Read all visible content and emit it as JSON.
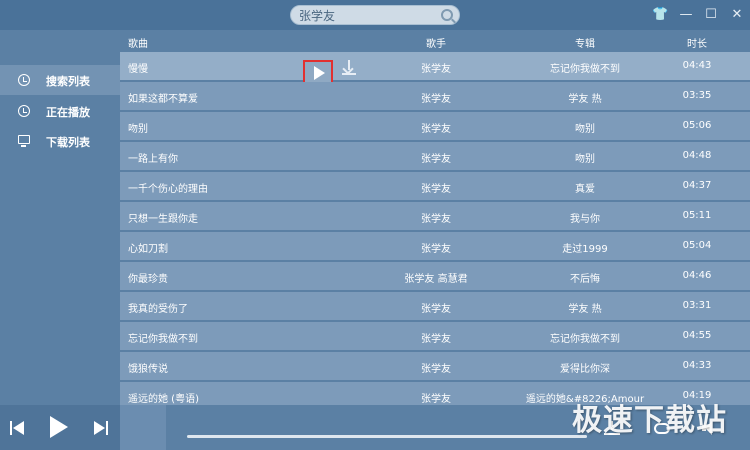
{
  "search": {
    "value": "张学友"
  },
  "sidebar": {
    "items": [
      {
        "label": "搜索列表",
        "icon": "clock-icon",
        "active": true
      },
      {
        "label": "正在播放",
        "icon": "clock-icon",
        "active": false
      },
      {
        "label": "下载列表",
        "icon": "monitor-icon",
        "active": false
      }
    ]
  },
  "table": {
    "headers": {
      "song": "歌曲",
      "artist": "歌手",
      "album": "专辑",
      "duration": "时长"
    },
    "rows": [
      {
        "song": "慢慢",
        "artist": "张学友",
        "album": "忘记你我做不到",
        "duration": "04:43"
      },
      {
        "song": "如果这都不算爱",
        "artist": "张学友",
        "album": "学友 热",
        "duration": "03:35"
      },
      {
        "song": "吻别",
        "artist": "张学友",
        "album": "吻别",
        "duration": "05:06"
      },
      {
        "song": "一路上有你",
        "artist": "张学友",
        "album": "吻别",
        "duration": "04:48"
      },
      {
        "song": "一千个伤心的理由",
        "artist": "张学友",
        "album": "真爱",
        "duration": "04:37"
      },
      {
        "song": "只想一生跟你走",
        "artist": "张学友",
        "album": "我与你",
        "duration": "05:11"
      },
      {
        "song": "心如刀割",
        "artist": "张学友",
        "album": "走过1999",
        "duration": "05:04"
      },
      {
        "song": "你最珍贵",
        "artist": "张学友 高慧君",
        "album": "不后悔",
        "duration": "04:46"
      },
      {
        "song": "我真的受伤了",
        "artist": "张学友",
        "album": "学友 热",
        "duration": "03:31"
      },
      {
        "song": "忘记你我做不到",
        "artist": "张学友",
        "album": "忘记你我做不到",
        "duration": "04:55"
      },
      {
        "song": "饿狼传说",
        "artist": "张学友",
        "album": "爱得比你深",
        "duration": "04:33"
      },
      {
        "song": "遥远的她 (粤语)",
        "artist": "张学友",
        "album": "遥远的她&#8226;Amour",
        "duration": "04:19"
      }
    ]
  },
  "player": {
    "progress": 0.0
  },
  "watermark": {
    "text": "极速下载站"
  }
}
